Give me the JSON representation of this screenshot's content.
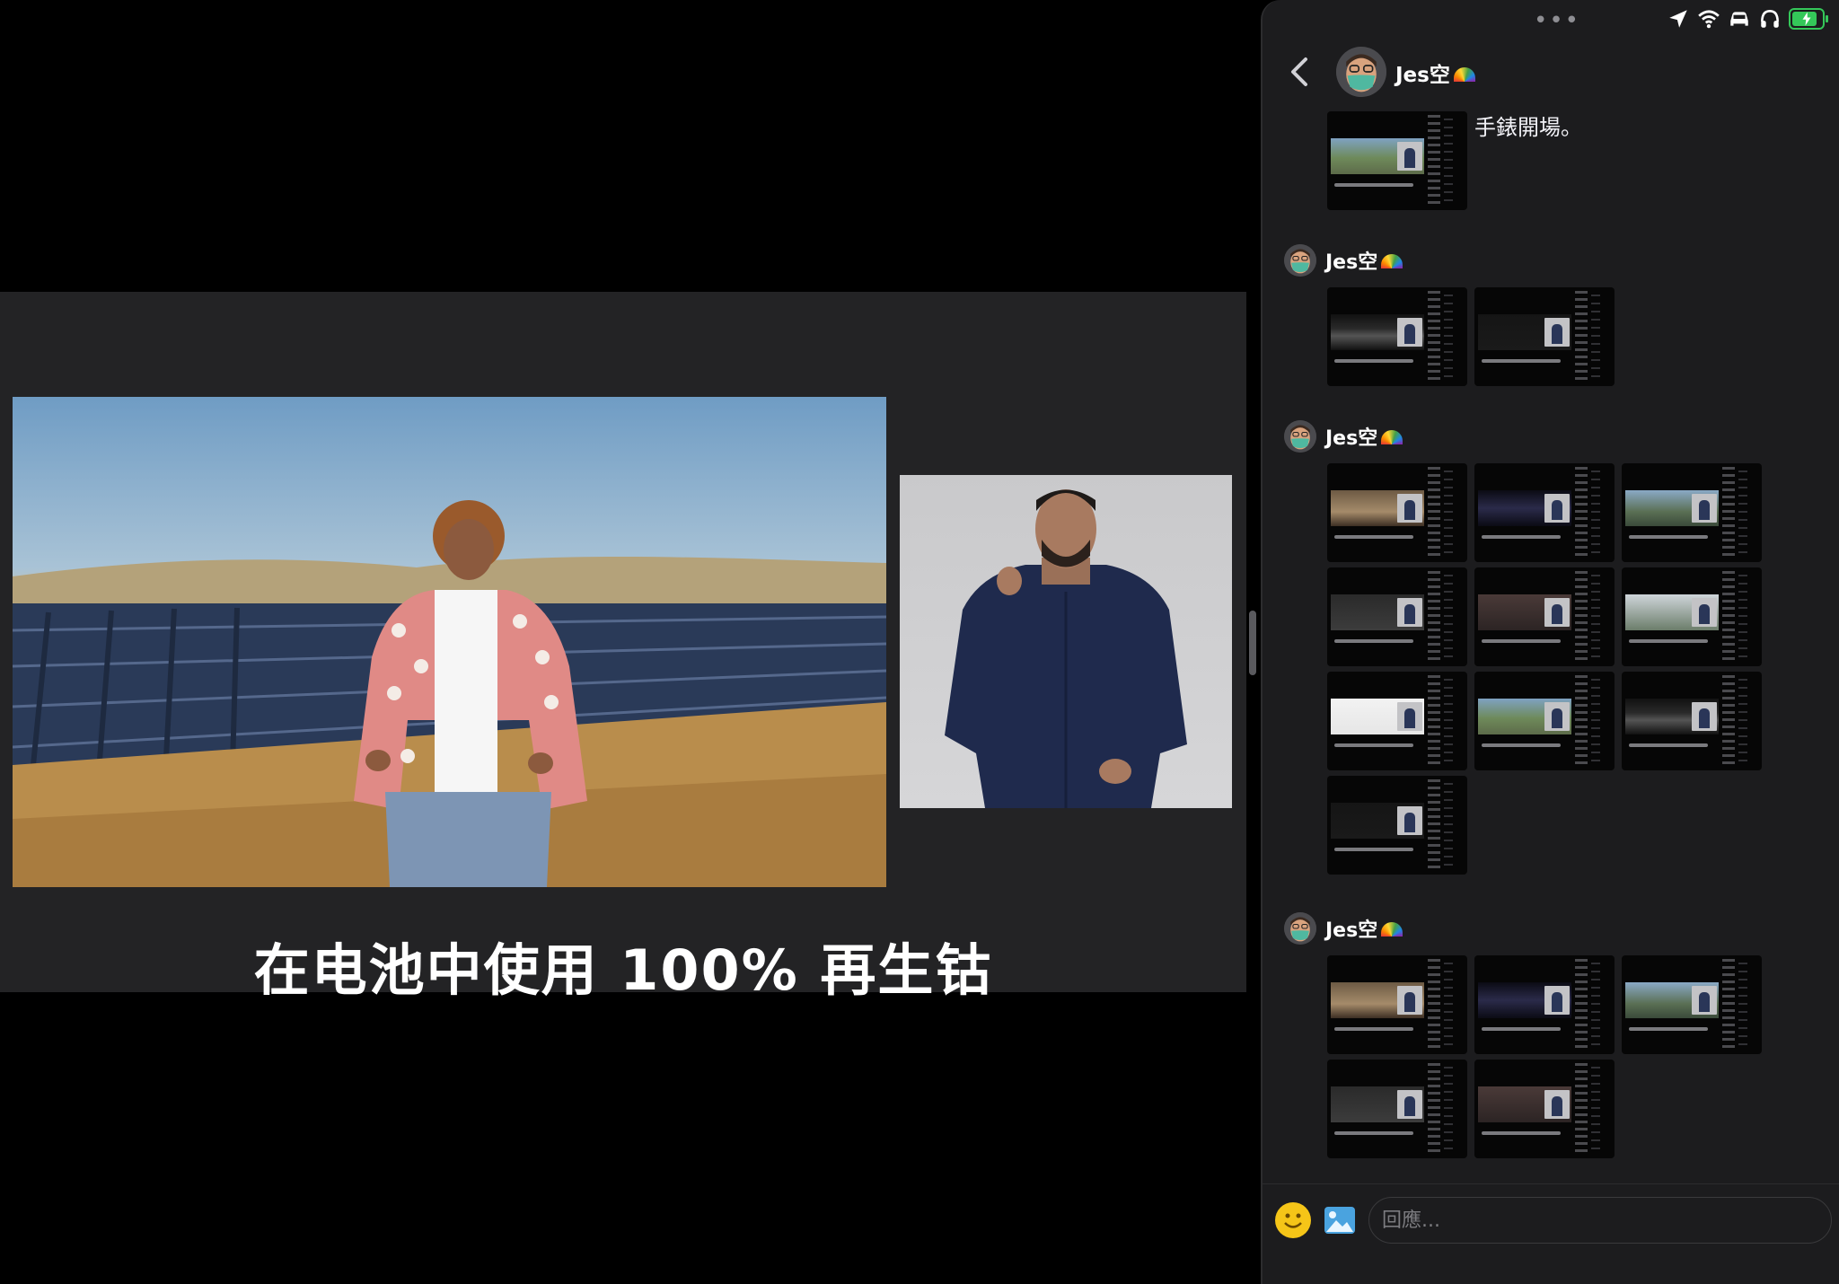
{
  "video": {
    "subtitle": "在电池中使用 100% 再生钴"
  },
  "status_bar": {
    "multitask_dots": "•••",
    "icons": [
      "location-arrow-icon",
      "wifi-icon",
      "car-icon",
      "headphones-icon",
      "battery-charging-icon"
    ],
    "battery_level": 0.85,
    "battery_color": "#34c759"
  },
  "chat": {
    "contact_name": "Jes空",
    "text_message": "手錶開場。",
    "groups": [
      {
        "sender": "Jes空",
        "thumbnails": 2
      },
      {
        "sender": "Jes空",
        "thumbnails": 10
      },
      {
        "sender": "Jes空",
        "thumbnails": 5
      }
    ]
  },
  "composer": {
    "placeholder": "回應...",
    "emoji_icon": "smiley-icon",
    "image_icon": "photo-icon"
  },
  "colors": {
    "chat_background": "#1c1c1e",
    "video_frame": "#232325",
    "accent_green": "#34c759",
    "emoji_yellow": "#f5c518",
    "photo_blue": "#4aa3df"
  }
}
